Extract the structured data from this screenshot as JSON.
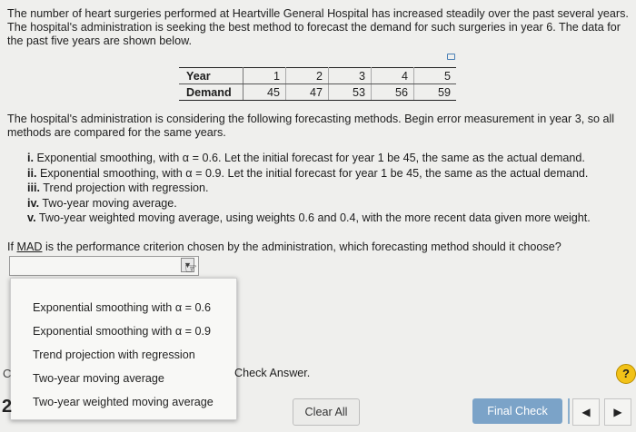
{
  "problem": {
    "intro": "The number of heart surgeries performed at Heartville General Hospital has increased steadily over the past several years. The hospital's administration is seeking the best method to forecast the demand for such surgeries in year 6. The data for the past five years are shown below.",
    "table": {
      "row1_label": "Year",
      "row2_label": "Demand",
      "years": [
        "1",
        "2",
        "3",
        "4",
        "5"
      ],
      "demand": [
        "45",
        "47",
        "53",
        "56",
        "59"
      ]
    },
    "para2": "The hospital's administration is considering the following forecasting methods. Begin error measurement in year 3, so all methods are compared for the same years.",
    "methods": [
      {
        "num": "i.",
        "text": "Exponential smoothing, with α = 0.6. Let the initial forecast for year 1 be 45, the same as the actual demand."
      },
      {
        "num": "ii.",
        "text": "Exponential smoothing, with α = 0.9. Let the initial forecast for year 1 be 45, the same as the actual demand."
      },
      {
        "num": "iii.",
        "text": "Trend projection with regression."
      },
      {
        "num": "iv.",
        "text": "Two-year moving average."
      },
      {
        "num": "v.",
        "text": "Two-year weighted moving average, using weights 0.6 and 0.4, with the more recent data given more weight."
      }
    ],
    "question_prefix": "If ",
    "question_term": "MAD",
    "question_suffix": " is the performance criterion chosen by the administration, which forecasting method should it choose?"
  },
  "dropdown": {
    "options": [
      "Exponential smoothing with α = 0.6",
      "Exponential smoothing with α = 0.9",
      "Trend projection with regression",
      "Two-year moving average",
      "Two-year weighted moving average"
    ]
  },
  "footer": {
    "check_answer": "Check Answer.",
    "left_c": "C",
    "left_2": "2",
    "help": "?",
    "clear_all": "Clear All",
    "final_check": "Final Check",
    "prev_arrow": "◀",
    "next_arrow": "▶"
  },
  "colors": {
    "final_check_bg": "#7ba3c8",
    "help_bg": "#f2c218"
  },
  "icons": [
    "copy-icon",
    "hand-cursor-icon",
    "dropdown-caret-icon",
    "help-icon",
    "prev-arrow-icon",
    "next-arrow-icon"
  ]
}
